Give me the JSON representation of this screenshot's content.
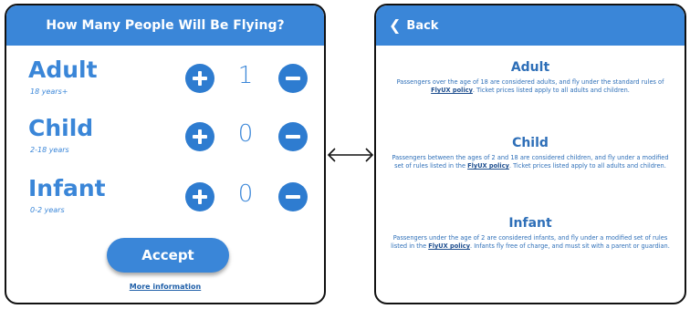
{
  "left_panel": {
    "title": "How Many People Will Be Flying?",
    "rows": [
      {
        "type": "Adult",
        "age": "18 years+",
        "count": "1"
      },
      {
        "type": "Child",
        "age": "2-18 years",
        "count": "0"
      },
      {
        "type": "Infant",
        "age": "0-2 years",
        "count": "0"
      }
    ],
    "accept_label": "Accept",
    "more_info_label": "More information"
  },
  "right_panel": {
    "back_label": "Back",
    "sections": [
      {
        "title": "Adult",
        "text_before": "Passengers over the age of 18 are considered adults, and fly under the standard rules of ",
        "link": "FlyUX policy",
        "text_after": ". Ticket prices listed apply to all adults and children."
      },
      {
        "title": "Child",
        "text_before": "Passengers between the ages of 2 and 18 are considered children, and fly under a modified set of rules listed in the ",
        "link": "FlyUX policy",
        "text_after": ". Ticket prices listed apply to all adults and children."
      },
      {
        "title": "Infant",
        "text_before": "Passengers under the age of 2 are considered infants, and fly under a modified set of rules listed in the ",
        "link": "FlyUX policy",
        "text_after": ". Infants fly free of charge, and must sit with a parent or guardian."
      }
    ]
  },
  "colors": {
    "accent": "#3a86d8",
    "button": "#2e7cd0",
    "border": "#111111"
  },
  "icons": {
    "plus": "plus-circle-icon",
    "minus": "minus-circle-icon",
    "back": "chevron-left-icon",
    "connector": "double-arrow-icon"
  }
}
